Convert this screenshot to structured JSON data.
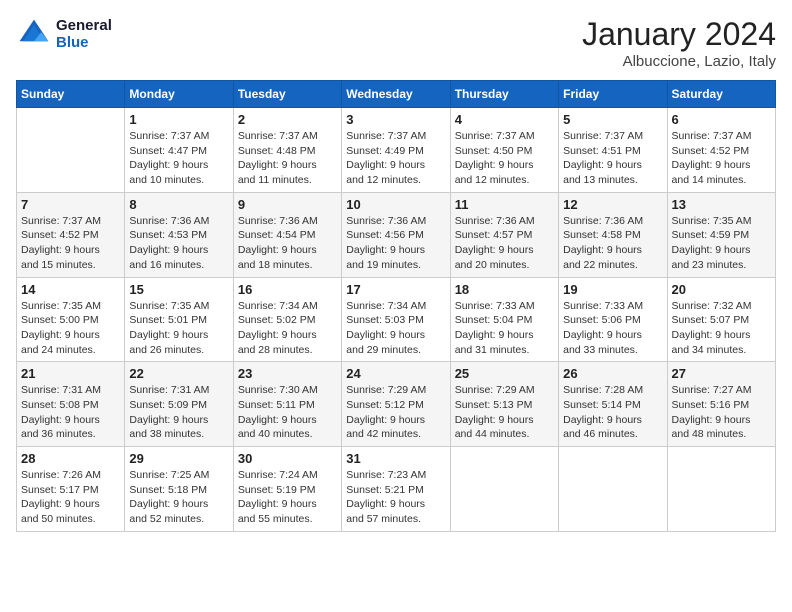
{
  "header": {
    "logo": {
      "line1": "General",
      "line2": "Blue"
    },
    "title": "January 2024",
    "location": "Albuccione, Lazio, Italy"
  },
  "weekdays": [
    "Sunday",
    "Monday",
    "Tuesday",
    "Wednesday",
    "Thursday",
    "Friday",
    "Saturday"
  ],
  "weeks": [
    [
      {
        "day": "",
        "info": ""
      },
      {
        "day": "1",
        "info": "Sunrise: 7:37 AM\nSunset: 4:47 PM\nDaylight: 9 hours\nand 10 minutes."
      },
      {
        "day": "2",
        "info": "Sunrise: 7:37 AM\nSunset: 4:48 PM\nDaylight: 9 hours\nand 11 minutes."
      },
      {
        "day": "3",
        "info": "Sunrise: 7:37 AM\nSunset: 4:49 PM\nDaylight: 9 hours\nand 12 minutes."
      },
      {
        "day": "4",
        "info": "Sunrise: 7:37 AM\nSunset: 4:50 PM\nDaylight: 9 hours\nand 12 minutes."
      },
      {
        "day": "5",
        "info": "Sunrise: 7:37 AM\nSunset: 4:51 PM\nDaylight: 9 hours\nand 13 minutes."
      },
      {
        "day": "6",
        "info": "Sunrise: 7:37 AM\nSunset: 4:52 PM\nDaylight: 9 hours\nand 14 minutes."
      }
    ],
    [
      {
        "day": "7",
        "info": "Sunrise: 7:37 AM\nSunset: 4:52 PM\nDaylight: 9 hours\nand 15 minutes."
      },
      {
        "day": "8",
        "info": "Sunrise: 7:36 AM\nSunset: 4:53 PM\nDaylight: 9 hours\nand 16 minutes."
      },
      {
        "day": "9",
        "info": "Sunrise: 7:36 AM\nSunset: 4:54 PM\nDaylight: 9 hours\nand 18 minutes."
      },
      {
        "day": "10",
        "info": "Sunrise: 7:36 AM\nSunset: 4:56 PM\nDaylight: 9 hours\nand 19 minutes."
      },
      {
        "day": "11",
        "info": "Sunrise: 7:36 AM\nSunset: 4:57 PM\nDaylight: 9 hours\nand 20 minutes."
      },
      {
        "day": "12",
        "info": "Sunrise: 7:36 AM\nSunset: 4:58 PM\nDaylight: 9 hours\nand 22 minutes."
      },
      {
        "day": "13",
        "info": "Sunrise: 7:35 AM\nSunset: 4:59 PM\nDaylight: 9 hours\nand 23 minutes."
      }
    ],
    [
      {
        "day": "14",
        "info": "Sunrise: 7:35 AM\nSunset: 5:00 PM\nDaylight: 9 hours\nand 24 minutes."
      },
      {
        "day": "15",
        "info": "Sunrise: 7:35 AM\nSunset: 5:01 PM\nDaylight: 9 hours\nand 26 minutes."
      },
      {
        "day": "16",
        "info": "Sunrise: 7:34 AM\nSunset: 5:02 PM\nDaylight: 9 hours\nand 28 minutes."
      },
      {
        "day": "17",
        "info": "Sunrise: 7:34 AM\nSunset: 5:03 PM\nDaylight: 9 hours\nand 29 minutes."
      },
      {
        "day": "18",
        "info": "Sunrise: 7:33 AM\nSunset: 5:04 PM\nDaylight: 9 hours\nand 31 minutes."
      },
      {
        "day": "19",
        "info": "Sunrise: 7:33 AM\nSunset: 5:06 PM\nDaylight: 9 hours\nand 33 minutes."
      },
      {
        "day": "20",
        "info": "Sunrise: 7:32 AM\nSunset: 5:07 PM\nDaylight: 9 hours\nand 34 minutes."
      }
    ],
    [
      {
        "day": "21",
        "info": "Sunrise: 7:31 AM\nSunset: 5:08 PM\nDaylight: 9 hours\nand 36 minutes."
      },
      {
        "day": "22",
        "info": "Sunrise: 7:31 AM\nSunset: 5:09 PM\nDaylight: 9 hours\nand 38 minutes."
      },
      {
        "day": "23",
        "info": "Sunrise: 7:30 AM\nSunset: 5:11 PM\nDaylight: 9 hours\nand 40 minutes."
      },
      {
        "day": "24",
        "info": "Sunrise: 7:29 AM\nSunset: 5:12 PM\nDaylight: 9 hours\nand 42 minutes."
      },
      {
        "day": "25",
        "info": "Sunrise: 7:29 AM\nSunset: 5:13 PM\nDaylight: 9 hours\nand 44 minutes."
      },
      {
        "day": "26",
        "info": "Sunrise: 7:28 AM\nSunset: 5:14 PM\nDaylight: 9 hours\nand 46 minutes."
      },
      {
        "day": "27",
        "info": "Sunrise: 7:27 AM\nSunset: 5:16 PM\nDaylight: 9 hours\nand 48 minutes."
      }
    ],
    [
      {
        "day": "28",
        "info": "Sunrise: 7:26 AM\nSunset: 5:17 PM\nDaylight: 9 hours\nand 50 minutes."
      },
      {
        "day": "29",
        "info": "Sunrise: 7:25 AM\nSunset: 5:18 PM\nDaylight: 9 hours\nand 52 minutes."
      },
      {
        "day": "30",
        "info": "Sunrise: 7:24 AM\nSunset: 5:19 PM\nDaylight: 9 hours\nand 55 minutes."
      },
      {
        "day": "31",
        "info": "Sunrise: 7:23 AM\nSunset: 5:21 PM\nDaylight: 9 hours\nand 57 minutes."
      },
      {
        "day": "",
        "info": ""
      },
      {
        "day": "",
        "info": ""
      },
      {
        "day": "",
        "info": ""
      }
    ]
  ]
}
